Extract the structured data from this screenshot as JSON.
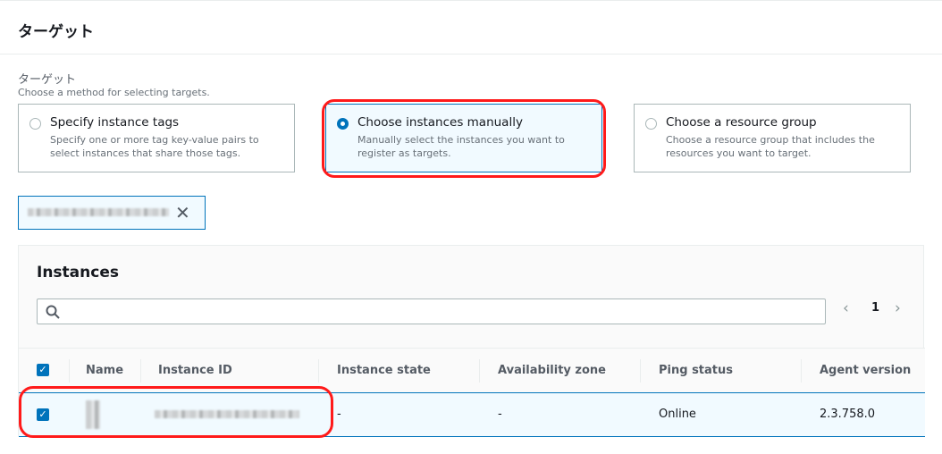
{
  "section": {
    "title": "ターゲット"
  },
  "field": {
    "label": "ターゲット",
    "description": "Choose a method for selecting targets."
  },
  "options": [
    {
      "title": "Specify instance tags",
      "description": "Specify one or more tag key-value pairs to select instances that share those tags.",
      "selected": false
    },
    {
      "title": "Choose instances manually",
      "description": "Manually select the instances you want to register as targets.",
      "selected": true
    },
    {
      "title": "Choose a resource group",
      "description": "Choose a resource group that includes the resources you want to target.",
      "selected": false
    }
  ],
  "token": {
    "remove_icon": "✕"
  },
  "instances": {
    "title": "Instances",
    "search_placeholder": "",
    "page": "1",
    "columns": [
      "Name",
      "Instance ID",
      "Instance state",
      "Availability zone",
      "Ping status",
      "Agent version"
    ],
    "rows": [
      {
        "state": "-",
        "az": "-",
        "ping": "Online",
        "agent": "2.3.758.0",
        "checked": true
      }
    ]
  },
  "colors": {
    "accent": "#0073bb",
    "highlight": "#ff1a1a"
  }
}
